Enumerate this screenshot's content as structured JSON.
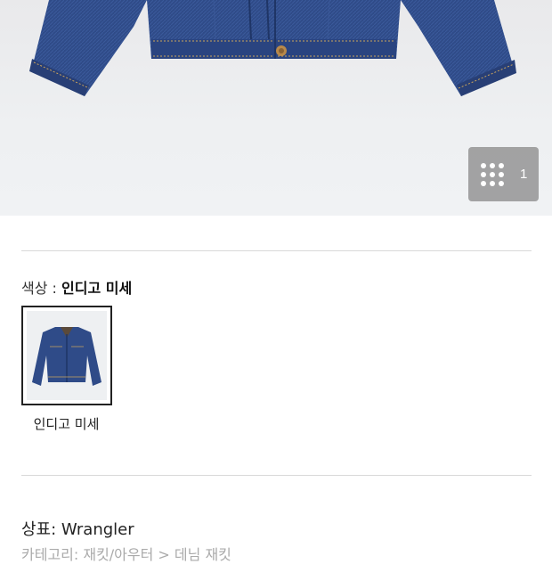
{
  "gallery": {
    "count": "1",
    "icon": "grid-dots-icon"
  },
  "color_section": {
    "label": "색상 : ",
    "selected": "인디고 미세",
    "swatches": [
      {
        "name": "인디고 미세"
      }
    ]
  },
  "brand": {
    "label": "상표: ",
    "value": "Wrangler"
  },
  "category": {
    "text": "카테고리: 재킷/아우터 > 데님 재킷"
  },
  "colors": {
    "denim": "#2e4a86",
    "denim_dark": "#22386b",
    "stitch": "#c9a35c"
  }
}
